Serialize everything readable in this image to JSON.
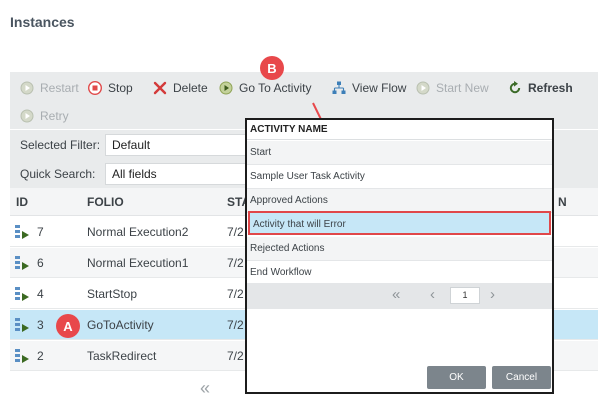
{
  "page": {
    "title": "Instances"
  },
  "toolbar": {
    "restart": "Restart",
    "stop": "Stop",
    "delete": "Delete",
    "go_to_activity": "Go To Activity",
    "view_flow": "View Flow",
    "start_new": "Start New",
    "refresh": "Refresh",
    "retry": "Retry"
  },
  "filters": {
    "selected_filter_label": "Selected Filter:",
    "selected_filter_value": "Default",
    "quick_search_label": "Quick Search:",
    "quick_search_value": "All fields"
  },
  "table": {
    "headers": {
      "id": "ID",
      "folio": "FOLIO",
      "start_partial": "STA",
      "end_partial": "N"
    },
    "rows": [
      {
        "id": "7",
        "folio": "Normal Execution2",
        "date": "7/2"
      },
      {
        "id": "6",
        "folio": "Normal Execution1",
        "date": "7/2"
      },
      {
        "id": "4",
        "folio": "StartStop",
        "date": "7/2"
      },
      {
        "id": "3",
        "folio": "GoToActivity",
        "date": "7/2"
      },
      {
        "id": "2",
        "folio": "TaskRedirect",
        "date": "7/2"
      }
    ],
    "pager_first": "«"
  },
  "callouts": {
    "a": "A",
    "b": "B"
  },
  "popup": {
    "header": "ACTIVITY NAME",
    "items": [
      "Start",
      "Sample User Task Activity",
      "Approved Actions",
      "Activity that will Error",
      "Rejected Actions",
      "End Workflow"
    ],
    "pager": {
      "first": "«",
      "prev": "‹",
      "page": "1",
      "next": "›"
    },
    "ok": "OK",
    "cancel": "Cancel"
  },
  "colors": {
    "accent_red": "#e8484b",
    "selection_blue": "#c6e7f7",
    "toolbar_bg": "#e9ebec"
  }
}
